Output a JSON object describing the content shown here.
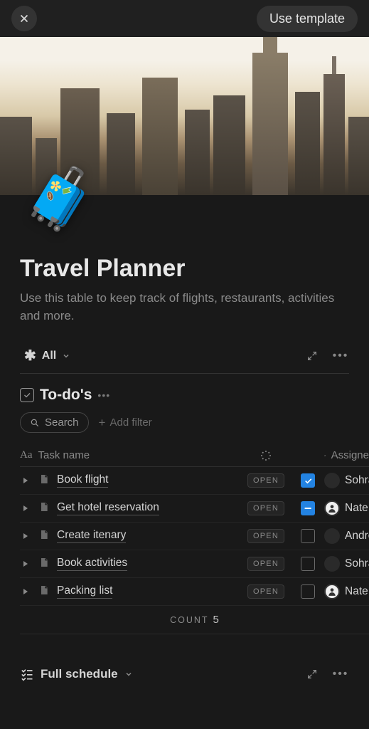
{
  "topbar": {
    "use_template_label": "Use template"
  },
  "page": {
    "icon": "🧳",
    "title": "Travel Planner",
    "description": "Use this table to keep track of flights, restaurants, activities and more."
  },
  "view_tabs": {
    "active": "All"
  },
  "section": {
    "title": "To-do's"
  },
  "filters": {
    "search_label": "Search",
    "add_filter_label": "Add filter"
  },
  "table": {
    "columns": {
      "name": "Task name",
      "assignee": "Assigne"
    },
    "open_label": "OPEN",
    "rows": [
      {
        "name": "Book flight",
        "check": "checked",
        "assignee": "Sohrab",
        "avatar": "dark"
      },
      {
        "name": "Get hotel reservation",
        "check": "minus",
        "assignee": "Nate M",
        "avatar": "ring"
      },
      {
        "name": "Create itenary",
        "check": "empty",
        "assignee": "Andrea",
        "avatar": "dark"
      },
      {
        "name": "Book activities",
        "check": "empty",
        "assignee": "Sohrab",
        "avatar": "dark"
      },
      {
        "name": "Packing list",
        "check": "empty",
        "assignee": "Nate M",
        "avatar": "ring"
      }
    ],
    "count_label": "COUNT",
    "count_value": "5"
  },
  "bottom_view": {
    "label": "Full schedule"
  }
}
